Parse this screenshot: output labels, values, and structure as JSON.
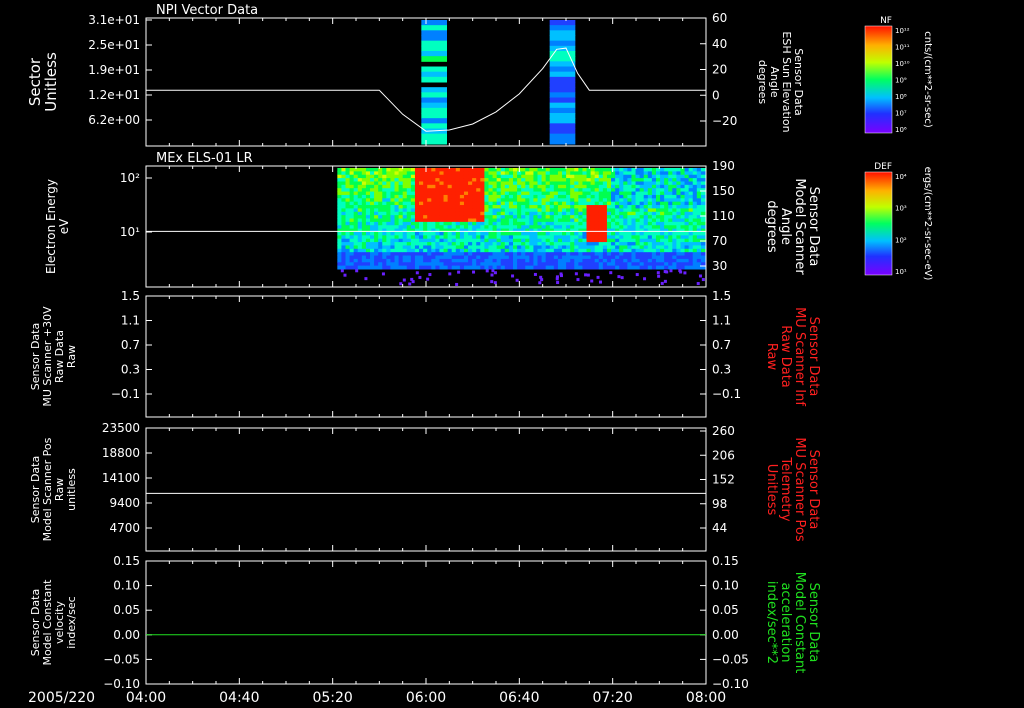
{
  "date_label": "2005/220",
  "x_ticks": [
    "04:00",
    "04:40",
    "05:20",
    "06:00",
    "06:40",
    "07:20",
    "08:00"
  ],
  "panels": [
    {
      "id": "npi",
      "title": "NPI Vector Data",
      "left_label": [
        "Sector",
        "Unitless"
      ],
      "left_ticks": [
        "3.1e+01",
        "2.5e+01",
        "1.9e+01",
        "1.2e+01",
        "6.2e+00"
      ],
      "right_label": [
        "Sensor Data",
        "ESH Sun Elevation",
        "Angle",
        "degrees"
      ],
      "right_ticks": [
        "60",
        "40",
        "20",
        "0",
        "−20"
      ],
      "right_label_color": "#ffffff"
    },
    {
      "id": "els",
      "title": "MEx ELS-01 LR",
      "left_label": [
        "Electron Energy",
        "eV"
      ],
      "left_ticks": [
        "10²",
        "10¹"
      ],
      "right_label": [
        "Sensor Data",
        "Model Scanner",
        "Angle",
        "degrees"
      ],
      "right_ticks": [
        "190",
        "150",
        "110",
        "70",
        "30"
      ],
      "right_label_color": "#ffffff"
    },
    {
      "id": "mu-raw",
      "title": "",
      "left_label": [
        "Sensor Data",
        "MU Scanner +30V",
        "Raw Data",
        "Raw"
      ],
      "left_ticks": [
        "1.5",
        "1.1",
        "0.7",
        "0.3",
        "−0.1"
      ],
      "right_label": [
        "Sensor Data",
        "MU Scanner Inf",
        "Raw Data",
        "Raw"
      ],
      "right_ticks": [
        "1.5",
        "1.1",
        "0.7",
        "0.3",
        "−0.1"
      ],
      "right_label_color": "#ff2020"
    },
    {
      "id": "scan-pos",
      "title": "",
      "left_label": [
        "Sensor Data",
        "Model Scanner Pos",
        "Raw",
        "unitless"
      ],
      "left_ticks": [
        "23500",
        "18800",
        "14100",
        "9400",
        "4700"
      ],
      "right_label": [
        "Sensor Data",
        "MU Scanner Pos",
        "Telemetry",
        "Unitless"
      ],
      "right_ticks": [
        "260",
        "206",
        "152",
        "98",
        "44"
      ],
      "right_label_color": "#ff2020"
    },
    {
      "id": "constant",
      "title": "",
      "left_label": [
        "Sensor Data",
        "Model Constant",
        "velocity",
        "index/sec"
      ],
      "left_ticks": [
        "0.15",
        "0.10",
        "0.05",
        "0.00",
        "−0.05",
        "−0.10"
      ],
      "right_label": [
        "Sensor Data",
        "Model Constant",
        "acceleration",
        "index/sec**2"
      ],
      "right_ticks": [
        "0.15",
        "0.10",
        "0.05",
        "0.00",
        "−0.05",
        "−0.10"
      ],
      "right_label_color": "#20e020"
    }
  ],
  "colorbars": [
    {
      "id": "nf",
      "label": "NF",
      "ticks": [
        "10¹²",
        "10¹¹",
        "10¹⁰",
        "10⁹",
        "10⁸",
        "10⁷",
        "10⁶"
      ],
      "units": "cnts/(cm**2-sr-sec)"
    },
    {
      "id": "def",
      "label": "DEF",
      "ticks": [
        "10⁴",
        "10³",
        "10²",
        "10¹"
      ],
      "units": "ergs/(cm**2-sr-sec-eV)"
    }
  ],
  "chart_data": [
    {
      "type": "heatmap",
      "title": "NPI Vector Data",
      "ylabel": "Sector Unitless",
      "y_scale": "log",
      "ylim": [
        4.4,
        31
      ],
      "x_range": [
        "04:00",
        "08:00"
      ],
      "data_blocks": [
        {
          "start": "05:58",
          "end": "06:09"
        },
        {
          "start": "06:53",
          "end": "07:04"
        }
      ],
      "colorscale": "NF",
      "overlay_series": {
        "name": "ESH Sun Elevation Angle",
        "axis": "right",
        "ylim": [
          -38,
          60
        ],
        "x": [
          "04:00",
          "05:40",
          "05:50",
          "06:00",
          "06:10",
          "06:20",
          "06:30",
          "06:40",
          "06:50",
          "06:56",
          "07:00",
          "07:05",
          "07:10",
          "08:00"
        ],
        "y": [
          0,
          0,
          -20,
          -34,
          -33,
          -28,
          -18,
          -3,
          18,
          34,
          35,
          14,
          0,
          0
        ]
      }
    },
    {
      "type": "heatmap",
      "title": "MEx ELS-01 LR",
      "ylabel": "Electron Energy eV",
      "y_scale": "log",
      "ylim": [
        1,
        200
      ],
      "x_range": [
        "04:00",
        "08:00"
      ],
      "data_start": "05:22",
      "colorscale": "DEF",
      "overlay_series": {
        "name": "Model Scanner Angle",
        "axis": "right",
        "ylim": [
          5,
          190
        ],
        "x": [
          "04:00",
          "08:00"
        ],
        "y": [
          90,
          90
        ]
      }
    },
    {
      "type": "line",
      "ylabel": "MU Scanner +30V Raw Data",
      "ylim": [
        -0.3,
        1.5
      ],
      "series": []
    },
    {
      "type": "line",
      "ylabel": "Model Scanner Pos Raw",
      "ylim": [
        0,
        23500
      ],
      "series": [
        {
          "x": [
            "04:00",
            "08:00"
          ],
          "y": [
            11000,
            11000
          ],
          "color": "#ffffff"
        }
      ]
    },
    {
      "type": "line",
      "ylabel": "Model Constant velocity",
      "ylim": [
        -0.1,
        0.15
      ],
      "series": [
        {
          "x": [
            "04:00",
            "08:00"
          ],
          "y": [
            0,
            0
          ],
          "color": "#20e020"
        }
      ]
    }
  ]
}
